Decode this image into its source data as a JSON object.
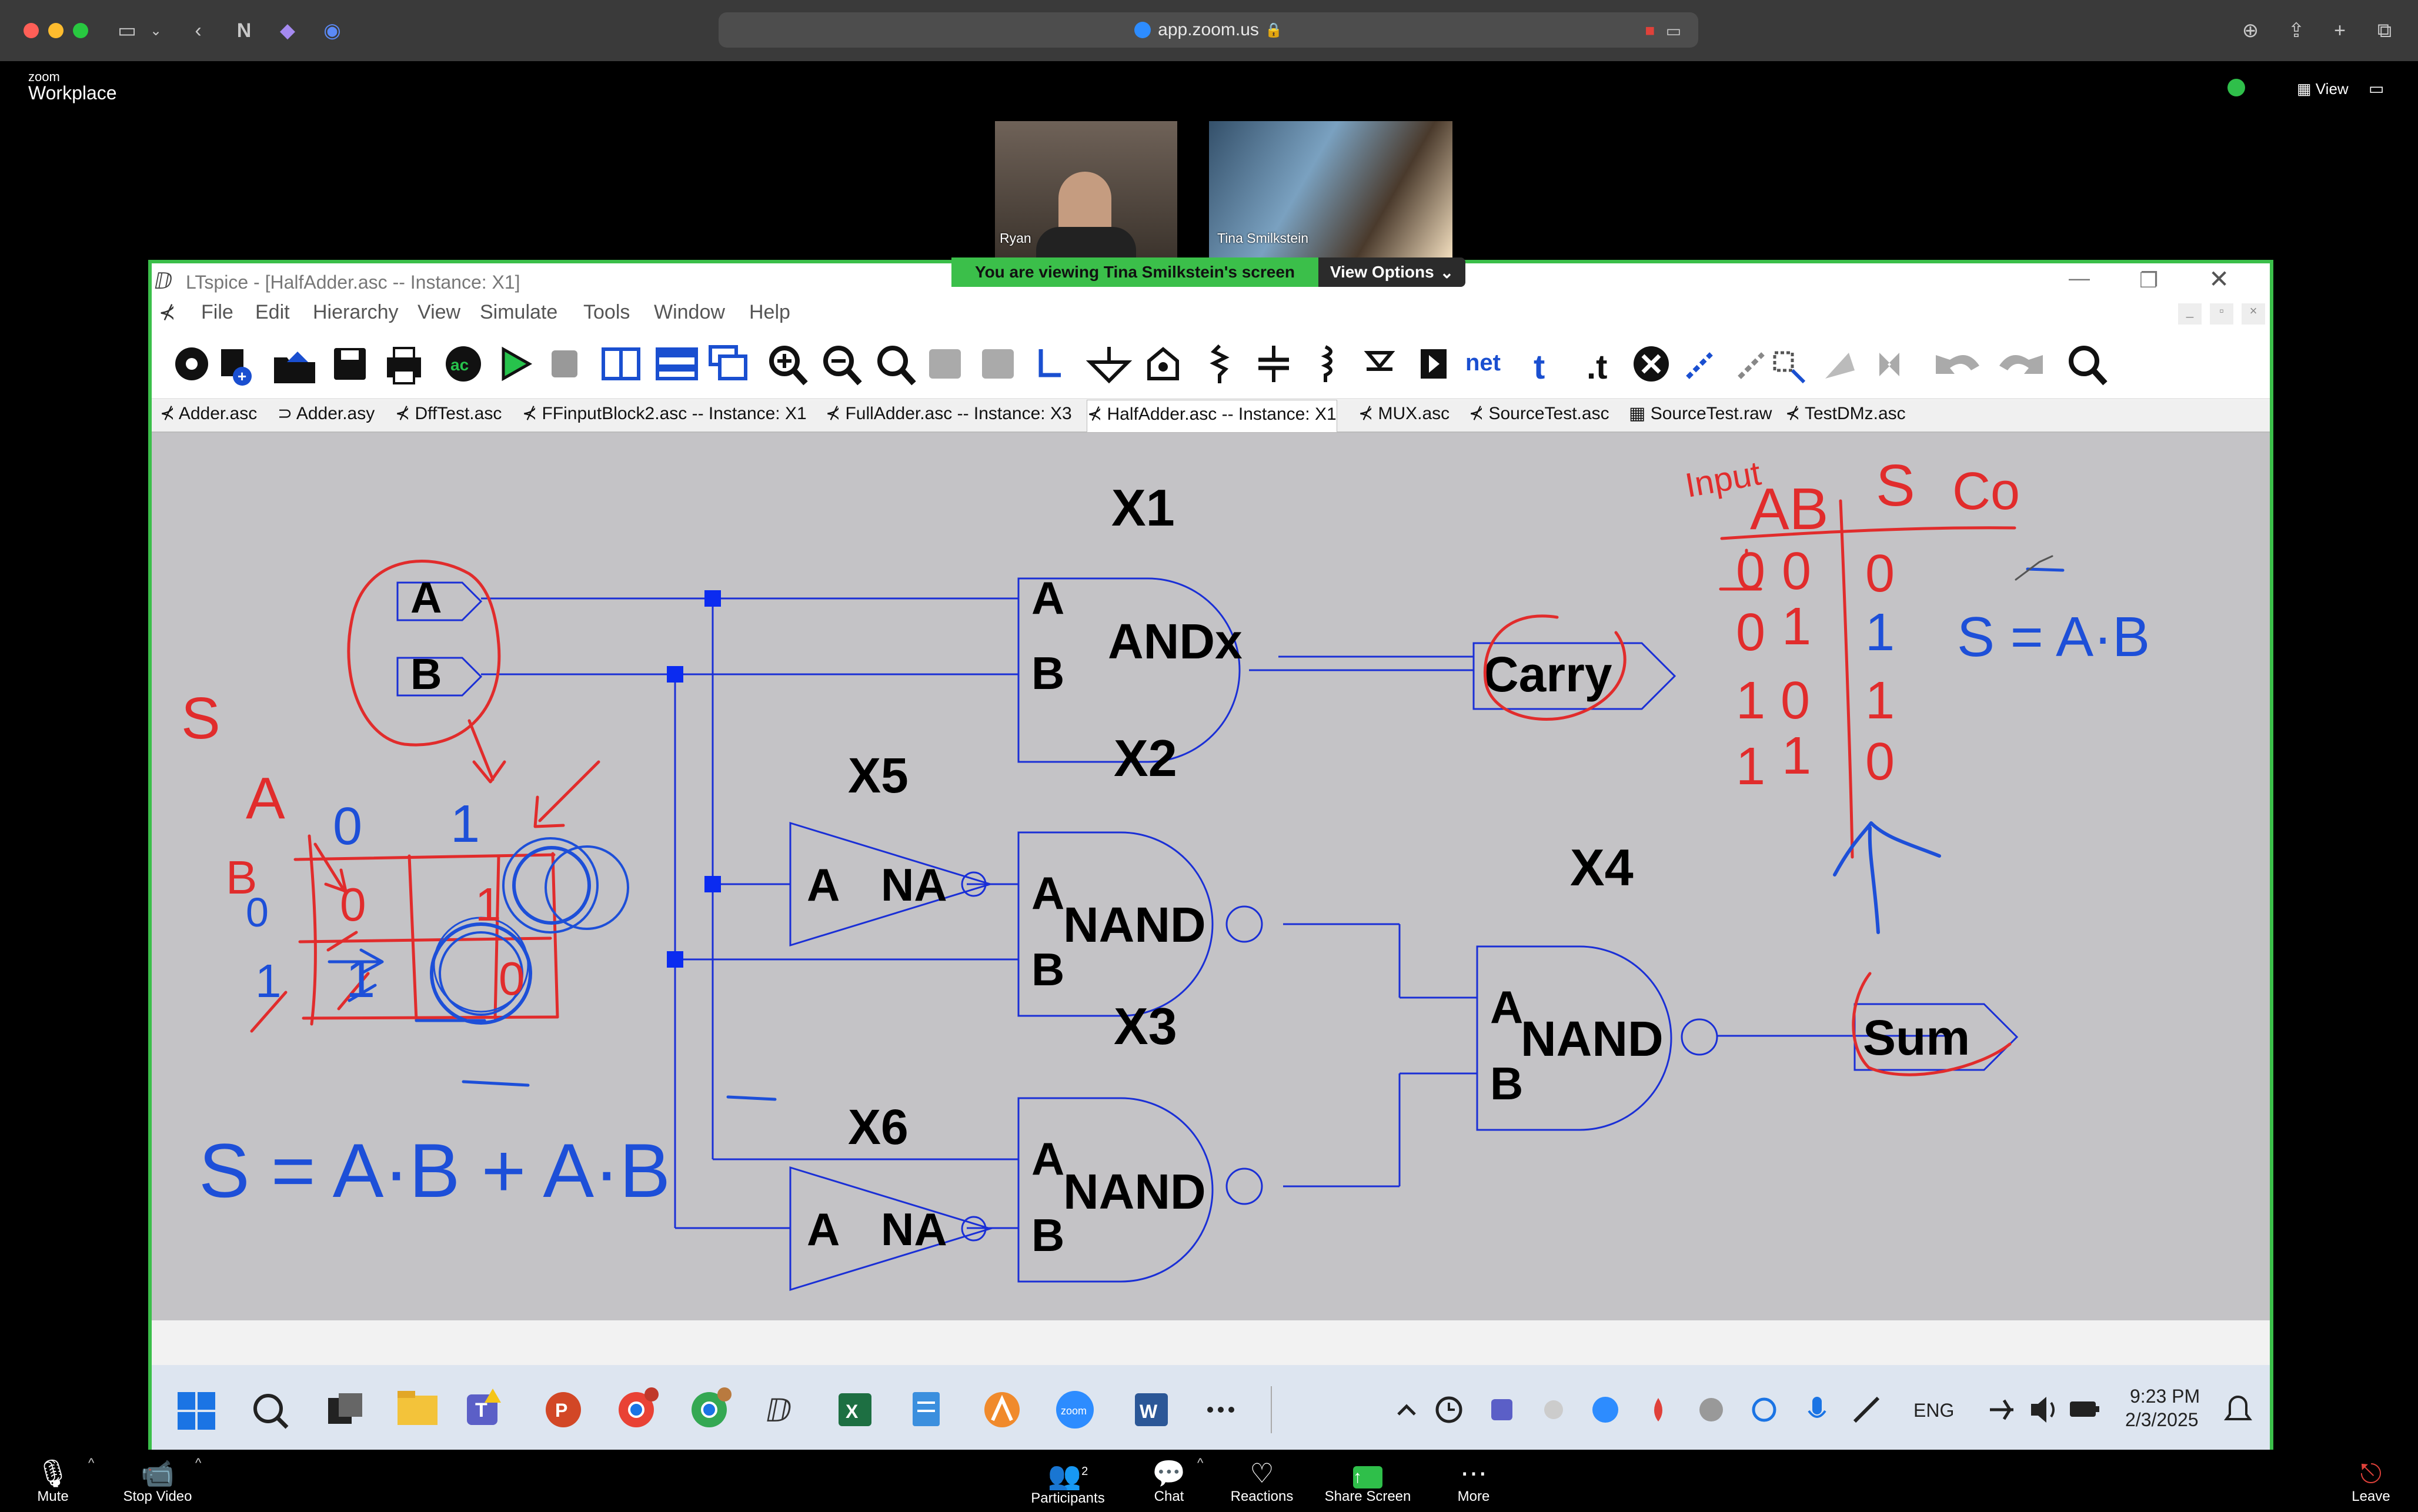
{
  "browser": {
    "url": "app.zoom.us"
  },
  "zoom": {
    "brand_small": "zoom",
    "brand_big": "Workplace",
    "view_label": "View",
    "participants": [
      {
        "name": "Ryan"
      },
      {
        "name": "Tina Smilkstein"
      }
    ],
    "banner_text": "You are viewing  Tina Smilkstein's screen",
    "view_options_label": "View Options",
    "controls": {
      "mute": "Mute",
      "stop_video": "Stop Video",
      "participants": "Participants",
      "participant_count": "2",
      "chat": "Chat",
      "reactions": "Reactions",
      "share_screen": "Share Screen",
      "more": "More",
      "leave": "Leave"
    }
  },
  "ltspice": {
    "window_title": "LTspice - [HalfAdder.asc -- Instance: X1]",
    "menu": [
      "File",
      "Edit",
      "Hierarchy",
      "View",
      "Simulate",
      "Tools",
      "Window",
      "Help"
    ],
    "tabs": [
      "Adder.asc",
      "Adder.asy",
      "DffTest.asc",
      "FFinputBlock2.asc -- Instance: X1",
      "FullAdder.asc -- Instance: X3",
      "HalfAdder.asc -- Instance: X1",
      "MUX.asc",
      "SourceTest.asc",
      "SourceTest.raw",
      "TestDMz.asc"
    ],
    "schematic": {
      "port_a": "A",
      "port_b": "B",
      "x1_label": "X1",
      "x1_gate": "ANDx",
      "x2_label": "X2",
      "x3_label": "X3",
      "x4_label": "X4",
      "x5_label": "X5",
      "x6_label": "X6",
      "nand": "NAND",
      "na": "NA",
      "pin_a": "A",
      "pin_b": "B",
      "carry": "Carry",
      "sum": "Sum"
    },
    "annotations": {
      "input": "Input",
      "ab": "AB",
      "s": "S",
      "co": "Co",
      "truth_rows": [
        {
          "a": "0",
          "b": "0",
          "s": "0"
        },
        {
          "a": "0",
          "b": "1",
          "s": "1"
        },
        {
          "a": "1",
          "b": "0",
          "s": "1"
        },
        {
          "a": "1",
          "b": "1",
          "s": "0"
        }
      ],
      "eq_right": "S = A·B",
      "eq_bottom": "S = A·B + A·B",
      "kmap_s": "S",
      "kmap_a": "A",
      "kmap_b": "B",
      "kmap_0": "0",
      "kmap_1": "1"
    }
  },
  "taskbar": {
    "lang": "ENG",
    "time": "9:23 PM",
    "date": "2/3/2025"
  }
}
